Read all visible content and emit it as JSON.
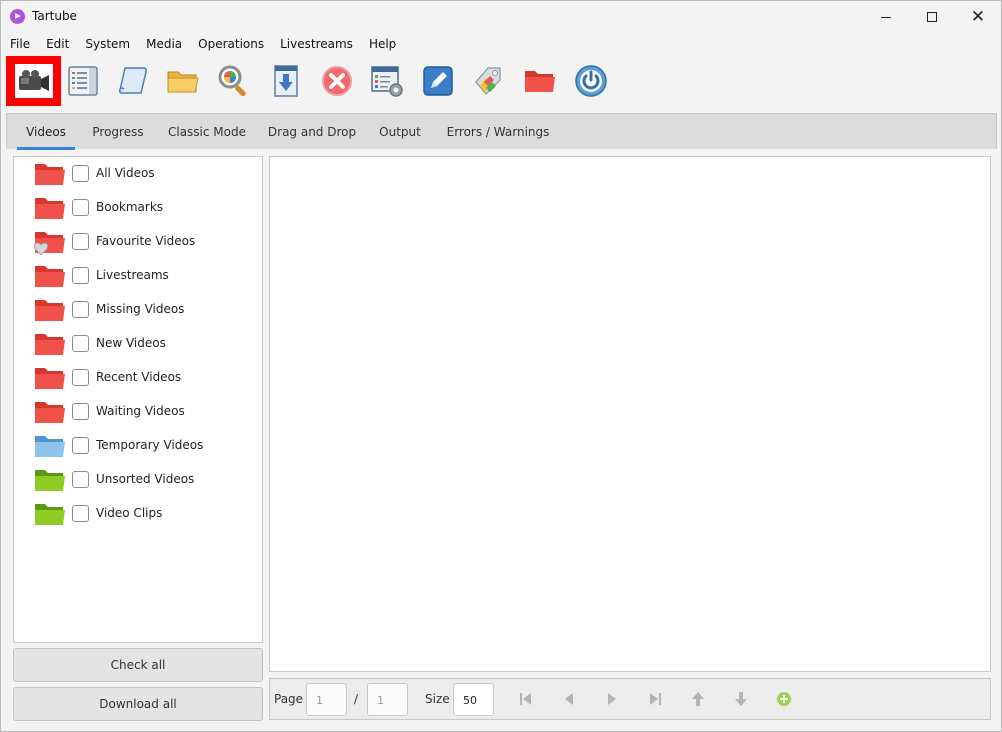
{
  "window": {
    "title": "Tartube"
  },
  "menu": [
    "File",
    "Edit",
    "System",
    "Media",
    "Operations",
    "Livestreams",
    "Help"
  ],
  "toolbar_icons": [
    "add-video-icon",
    "add-channel-icon",
    "add-playlist-icon",
    "add-folder-icon",
    "check-all-icon",
    "download-all-icon",
    "stop-icon",
    "preferences-icon",
    "edit-icon",
    "tags-icon",
    "folder-icon",
    "quit-icon"
  ],
  "tabs": [
    "Videos",
    "Progress",
    "Classic Mode",
    "Drag and Drop",
    "Output",
    "Errors / Warnings"
  ],
  "folders": [
    {
      "label": "All Videos",
      "color": "red"
    },
    {
      "label": "Bookmarks",
      "color": "red"
    },
    {
      "label": "Favourite Videos",
      "color": "red"
    },
    {
      "label": "Livestreams",
      "color": "red"
    },
    {
      "label": "Missing Videos",
      "color": "red"
    },
    {
      "label": "New Videos",
      "color": "red"
    },
    {
      "label": "Recent Videos",
      "color": "red"
    },
    {
      "label": "Waiting Videos",
      "color": "red"
    },
    {
      "label": "Temporary Videos",
      "color": "blue"
    },
    {
      "label": "Unsorted Videos",
      "color": "green"
    },
    {
      "label": "Video Clips",
      "color": "green"
    }
  ],
  "buttons": {
    "check_all": "Check all",
    "download_all": "Download all"
  },
  "pager": {
    "page_label": "Page",
    "page_value": "1",
    "separator": "/",
    "total_pages": "1",
    "size_label": "Size",
    "size_value": "50"
  },
  "colors": {
    "accent": "#3584e4",
    "highlight": "#ff0000",
    "folder_red": "#f0524a",
    "folder_blue": "#7ab8e6",
    "folder_green": "#7cbe1a"
  }
}
